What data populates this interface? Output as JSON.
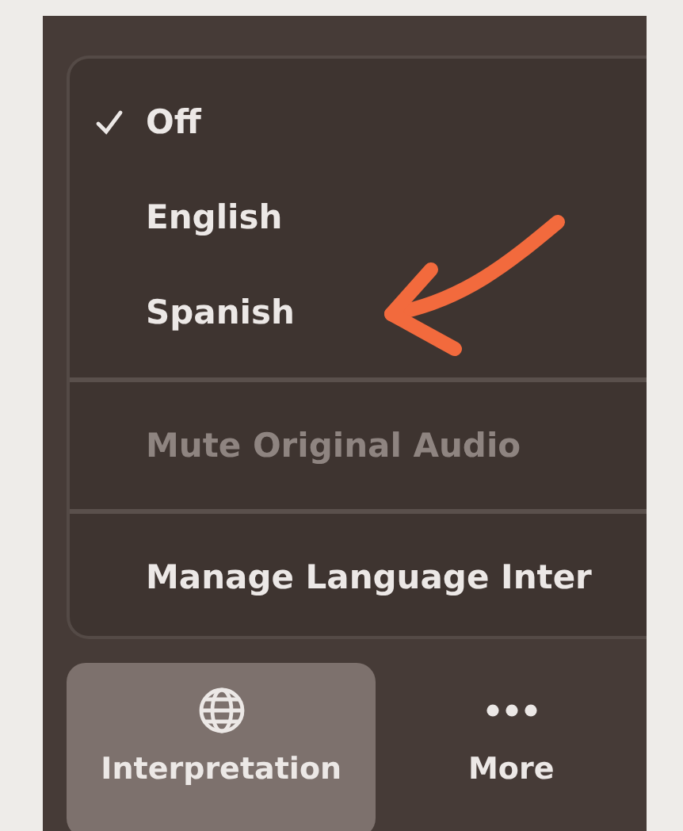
{
  "menu": {
    "sections": [
      {
        "items": [
          {
            "label": "Off",
            "checked": true,
            "disabled": false
          },
          {
            "label": "English",
            "checked": false,
            "disabled": false
          },
          {
            "label": "Spanish",
            "checked": false,
            "disabled": false
          }
        ]
      },
      {
        "items": [
          {
            "label": "Mute Original Audio",
            "checked": false,
            "disabled": true
          }
        ]
      },
      {
        "items": [
          {
            "label": "Manage Language Inter",
            "checked": false,
            "disabled": false
          }
        ]
      }
    ]
  },
  "toolbar": [
    {
      "kind": "globe",
      "label": "Interpretation",
      "selected": true
    },
    {
      "kind": "more",
      "label": "More",
      "selected": false
    }
  ]
}
